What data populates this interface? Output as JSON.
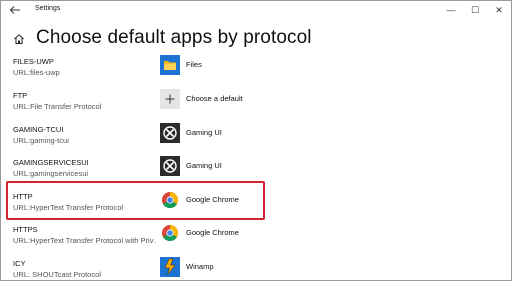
{
  "window": {
    "title": "Settings",
    "controls": {
      "minimize": "—",
      "maximize": "☐",
      "close": "✕"
    },
    "back_icon": "back-arrow-icon"
  },
  "header": {
    "home_icon": "home-icon",
    "title": "Choose default apps by protocol"
  },
  "rows": [
    {
      "name": "FILES-UWP",
      "desc": "URL:files-uwp",
      "app": "Files",
      "icon": "folder-icon"
    },
    {
      "name": "FTP",
      "desc": "URL:File Transfer Protocol",
      "app": "Choose a default",
      "icon": "plus-icon"
    },
    {
      "name": "GAMING-TCUI",
      "desc": "URL:gaming-tcui",
      "app": "Gaming UI",
      "icon": "xbox-icon"
    },
    {
      "name": "GAMINGSERVICESUI",
      "desc": "URL:gamingservicesui",
      "app": "Gaming UI",
      "icon": "xbox-icon"
    },
    {
      "name": "HTTP",
      "desc": "URL:HyperText Transfer Protocol",
      "app": "Google Chrome",
      "icon": "chrome-icon"
    },
    {
      "name": "HTTPS",
      "desc": "URL:HyperText Transfer Protocol with Priv…",
      "app": "Google Chrome",
      "icon": "chrome-icon"
    },
    {
      "name": "ICY",
      "desc": "URL: SHOUTcast Protocol",
      "app": "Winamp",
      "icon": "winamp-icon"
    }
  ],
  "highlight_color": "#d5232f"
}
